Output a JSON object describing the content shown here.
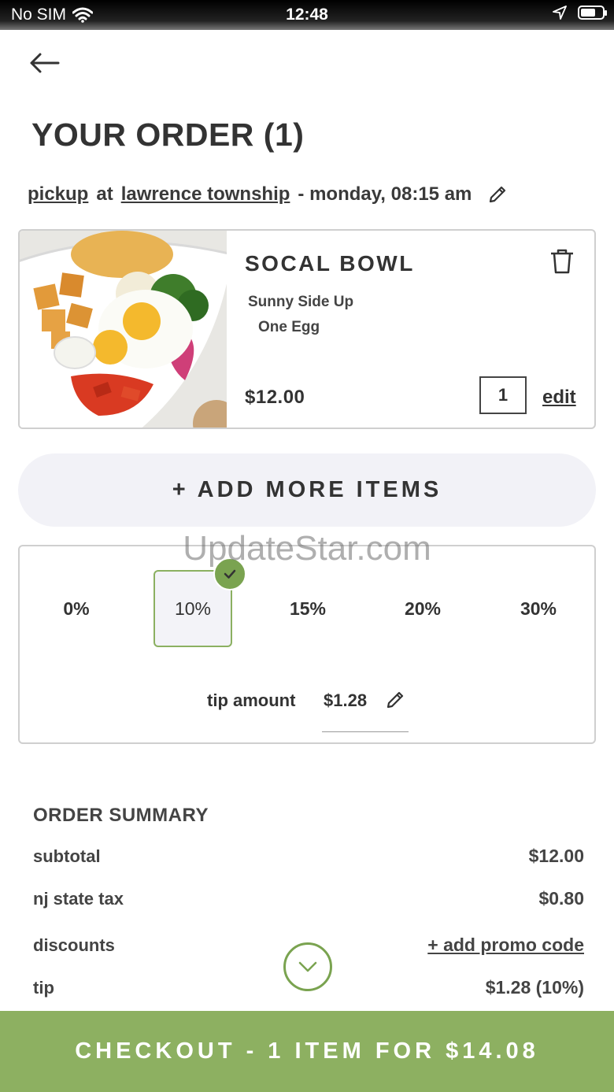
{
  "status_bar": {
    "carrier": "No SIM",
    "time": "12:48",
    "icons": [
      "wifi-icon",
      "location-arrow-icon",
      "battery-icon"
    ]
  },
  "header": {
    "back_icon": "arrow-left-icon",
    "title": "YOUR ORDER (1)"
  },
  "pickup": {
    "mode": "pickup",
    "at": "at",
    "location": "lawrence township",
    "datetime": "- monday, 08:15 am",
    "edit_icon": "pencil-icon"
  },
  "item": {
    "name": "SOCAL BOWL",
    "modifiers": [
      "Sunny Side Up",
      "One Egg"
    ],
    "price": "$12.00",
    "quantity": "1",
    "edit_label": "edit",
    "delete_icon": "trash-icon",
    "image": "socal-bowl-photo"
  },
  "add_more": {
    "label": "+ ADD MORE ITEMS"
  },
  "watermark": "UpdateStar.com",
  "tip": {
    "options": [
      "0%",
      "10%",
      "15%",
      "20%",
      "30%"
    ],
    "selected": "10%",
    "amount_label": "tip amount",
    "amount": "$1.28"
  },
  "summary": {
    "title": "ORDER SUMMARY",
    "subtotal_label": "subtotal",
    "subtotal_value": "$12.00",
    "tax_label": "nj state tax",
    "tax_value": "$0.80",
    "discounts_label": "discounts",
    "promo_label": "+ add promo code",
    "tip_label": "tip",
    "tip_value": "$1.28 (10%)"
  },
  "checkout": {
    "label": "CHECKOUT - 1 ITEM FOR $14.08"
  },
  "colors": {
    "accent_green": "#8db061",
    "check_green": "#7aa350",
    "pill_bg": "#f2f2f7",
    "text": "#333333"
  }
}
